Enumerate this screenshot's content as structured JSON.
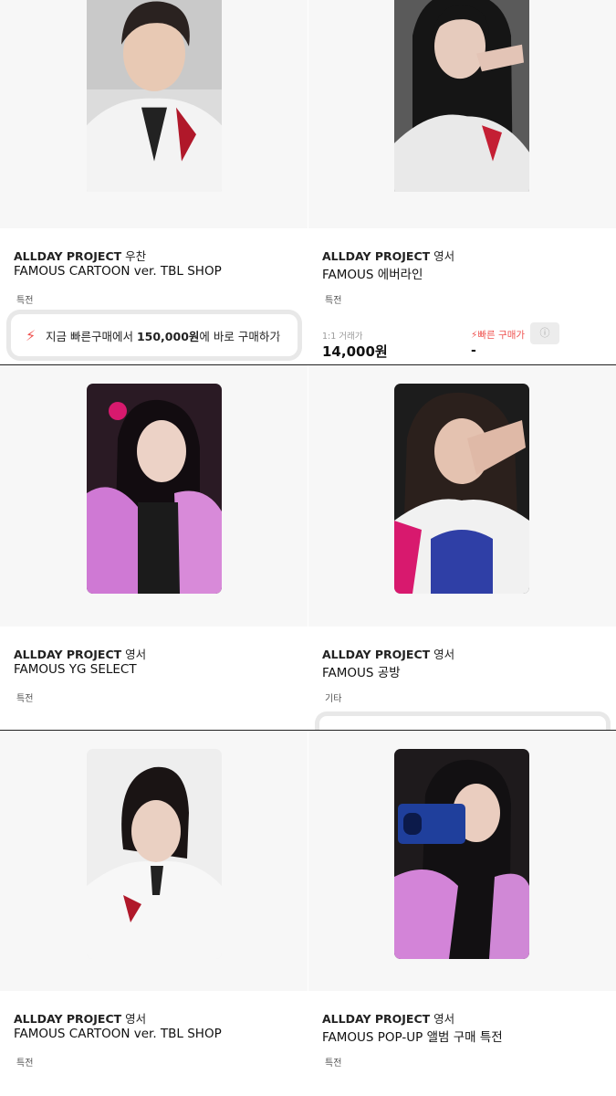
{
  "panel1": {
    "left": {
      "brand": "ALLDAY PROJECT",
      "member": "우찬",
      "title": "FAMOUS CARTOON ver. TBL SHOP",
      "tag": "특전",
      "promo": {
        "pre": "지금 빠른구매에서 ",
        "amount": "150,000원",
        "post": "에 바로 구매하기"
      }
    },
    "right": {
      "brand": "ALLDAY PROJECT",
      "member": "영서",
      "title": "FAMOUS 에버라인",
      "tag": "특전",
      "meta": "1:1 거래가",
      "price": "14,000원",
      "quick": "빠른 구매가",
      "quick_value": "-"
    }
  },
  "panel2": {
    "left": {
      "brand": "ALLDAY PROJECT",
      "member": "영서",
      "title": "FAMOUS YG SELECT",
      "tag": "특전"
    },
    "right": {
      "brand": "ALLDAY PROJECT",
      "member": "영서",
      "title": "FAMOUS 공방",
      "tag": "기타"
    }
  },
  "panel3": {
    "left": {
      "brand": "ALLDAY PROJECT",
      "member": "영서",
      "title": "FAMOUS CARTOON ver. TBL SHOP",
      "tag": "특전"
    },
    "right": {
      "brand": "ALLDAY PROJECT",
      "member": "영서",
      "title": "FAMOUS POP-UP 앨범 구매 특전",
      "tag": "특전"
    }
  },
  "icons": {
    "quick_buy": "lightning-icon",
    "info": "info-icon",
    "chevron": "chevron-right-icon"
  },
  "colors": {
    "accent": "#ef5350",
    "image_bg": "#f7f7f7"
  }
}
